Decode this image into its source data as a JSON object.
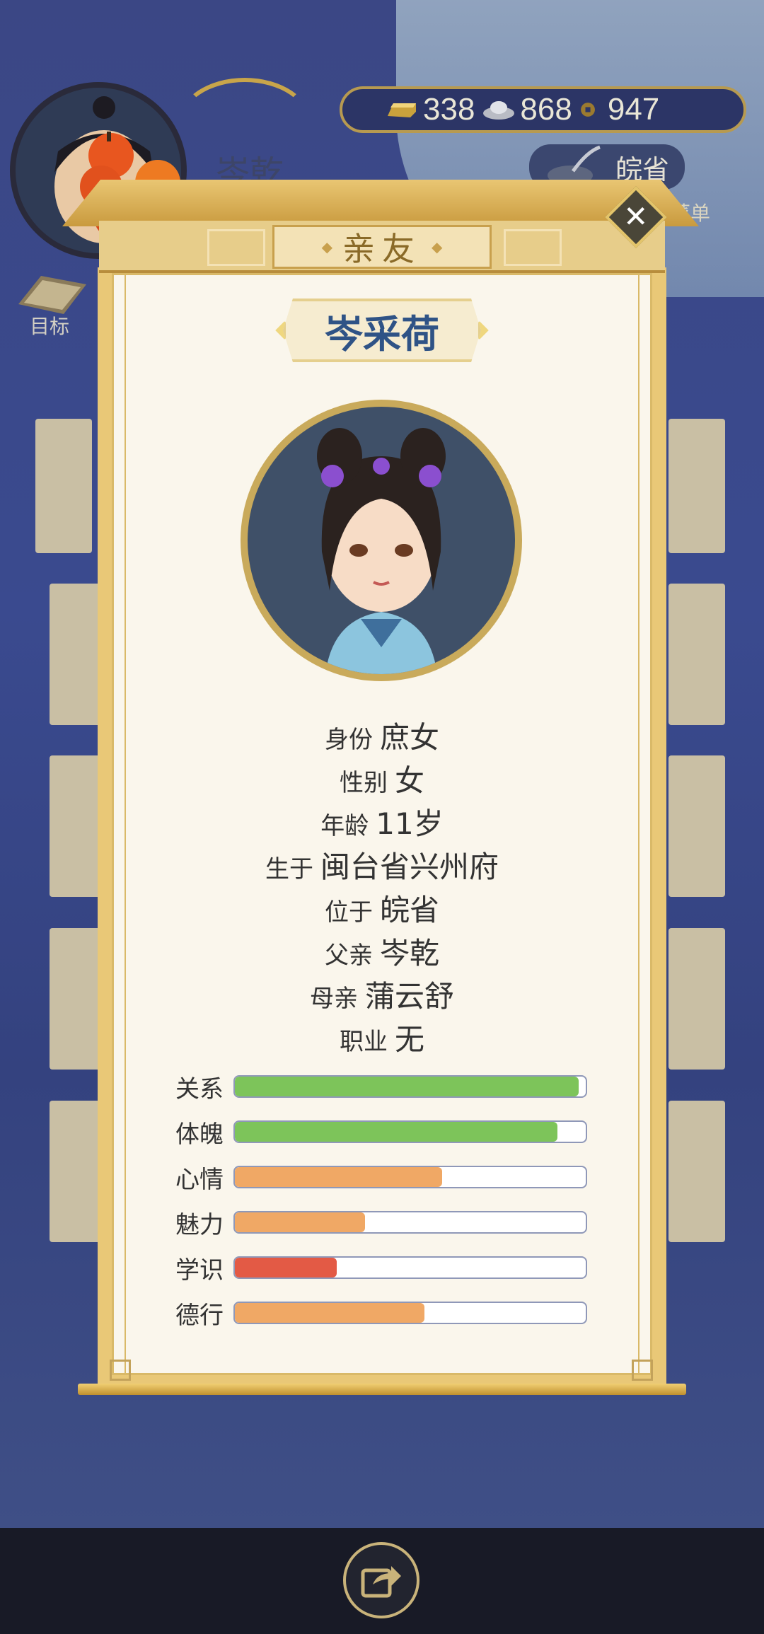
{
  "hud": {
    "player_name": "岑乾",
    "resources": [
      {
        "icon": "gold-ingot-icon",
        "value": "338"
      },
      {
        "icon": "silver-ingot-icon",
        "value": "868"
      },
      {
        "icon": "copper-coin-icon",
        "value": "947"
      }
    ],
    "location_button": "皖省",
    "menu_label": "菜单",
    "goal_label": "目标"
  },
  "dialog": {
    "title": "亲友",
    "name": "岑采荷",
    "info": [
      {
        "key": "身份",
        "value": "庶女"
      },
      {
        "key": "性别",
        "value": "女"
      },
      {
        "key": "年龄",
        "value": "11岁"
      },
      {
        "key": "生于",
        "value": "闽台省兴州府"
      },
      {
        "key": "位于",
        "value": "皖省"
      },
      {
        "key": "父亲",
        "value": "岑乾"
      },
      {
        "key": "母亲",
        "value": "蒲云舒"
      },
      {
        "key": "职业",
        "value": "无"
      }
    ],
    "stats": [
      {
        "label": "关系",
        "fraction": 0.98,
        "color": "#7dc45a"
      },
      {
        "label": "体魄",
        "fraction": 0.92,
        "color": "#7dc45a"
      },
      {
        "label": "心情",
        "fraction": 0.59,
        "color": "#f0a865"
      },
      {
        "label": "魅力",
        "fraction": 0.37,
        "color": "#f0a865"
      },
      {
        "label": "学识",
        "fraction": 0.29,
        "color": "#e35a45"
      },
      {
        "label": "德行",
        "fraction": 0.54,
        "color": "#f0a865"
      }
    ]
  }
}
